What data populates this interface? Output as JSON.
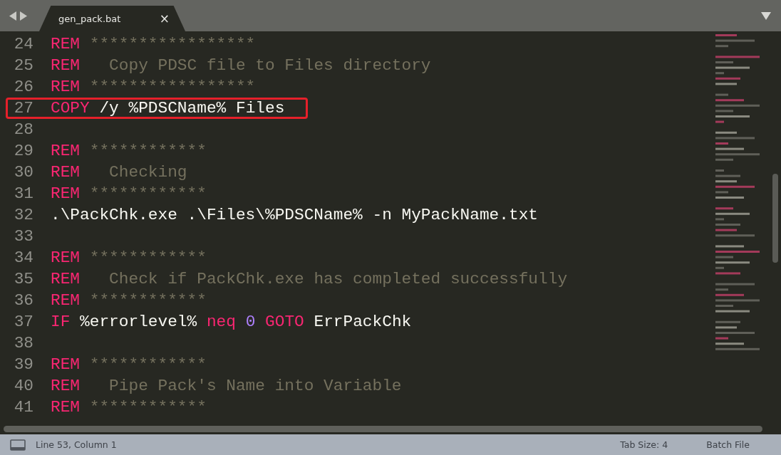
{
  "tabs": [
    {
      "title": "gen_pack.bat",
      "selected": true,
      "close": "×"
    }
  ],
  "lines": [
    {
      "number": "24",
      "highlighted": false,
      "tokens": [
        {
          "kind": "keyword",
          "text": "REM"
        },
        {
          "kind": "comment",
          "text": " *****************"
        }
      ]
    },
    {
      "number": "25",
      "highlighted": false,
      "tokens": [
        {
          "kind": "keyword",
          "text": "REM"
        },
        {
          "kind": "comment",
          "text": "   Copy PDSC file to Files directory"
        }
      ]
    },
    {
      "number": "26",
      "highlighted": false,
      "tokens": [
        {
          "kind": "keyword",
          "text": "REM"
        },
        {
          "kind": "comment",
          "text": " *****************"
        }
      ]
    },
    {
      "number": "27",
      "highlighted": true,
      "tokens": [
        {
          "kind": "keyword",
          "text": "COPY"
        },
        {
          "kind": "plain",
          "text": " /y %PDSCName% Files"
        }
      ]
    },
    {
      "number": "28",
      "highlighted": false
    },
    {
      "number": "29",
      "highlighted": false,
      "tokens": [
        {
          "kind": "keyword",
          "text": "REM"
        },
        {
          "kind": "comment",
          "text": " ************"
        }
      ]
    },
    {
      "number": "30",
      "highlighted": false,
      "tokens": [
        {
          "kind": "keyword",
          "text": "REM"
        },
        {
          "kind": "comment",
          "text": "   Checking"
        }
      ]
    },
    {
      "number": "31",
      "highlighted": false,
      "tokens": [
        {
          "kind": "keyword",
          "text": "REM"
        },
        {
          "kind": "comment",
          "text": " ************"
        }
      ]
    },
    {
      "number": "32",
      "highlighted": false,
      "tokens": [
        {
          "kind": "plain",
          "text": ".\\PackChk.exe .\\Files\\%PDSCName% -n MyPackName.txt"
        }
      ]
    },
    {
      "number": "33",
      "highlighted": false
    },
    {
      "number": "34",
      "highlighted": false,
      "tokens": [
        {
          "kind": "keyword",
          "text": "REM"
        },
        {
          "kind": "comment",
          "text": " ************"
        }
      ]
    },
    {
      "number": "35",
      "highlighted": false,
      "tokens": [
        {
          "kind": "keyword",
          "text": "REM"
        },
        {
          "kind": "comment",
          "text": "   Check if PackChk.exe has completed successfully"
        }
      ]
    },
    {
      "number": "36",
      "highlighted": false,
      "tokens": [
        {
          "kind": "keyword",
          "text": "REM"
        },
        {
          "kind": "comment",
          "text": " ************"
        }
      ]
    },
    {
      "number": "37",
      "highlighted": false,
      "tokens": [
        {
          "kind": "keyword",
          "text": "IF"
        },
        {
          "kind": "plain",
          "text": " %errorlevel% "
        },
        {
          "kind": "keyword",
          "text": "neq"
        },
        {
          "kind": "number",
          "text": " 0"
        },
        {
          "kind": "keyword",
          "text": " GOTO"
        },
        {
          "kind": "plain",
          "text": " ErrPackChk"
        }
      ]
    },
    {
      "number": "38",
      "highlighted": false
    },
    {
      "number": "39",
      "highlighted": false,
      "tokens": [
        {
          "kind": "keyword",
          "text": "REM"
        },
        {
          "kind": "comment",
          "text": " ************"
        }
      ]
    },
    {
      "number": "40",
      "highlighted": false,
      "tokens": [
        {
          "kind": "keyword",
          "text": "REM"
        },
        {
          "kind": "comment",
          "text": "   Pipe Pack's Name into Variable"
        }
      ]
    },
    {
      "number": "41",
      "highlighted": false,
      "tokens": [
        {
          "kind": "keyword",
          "text": "REM"
        },
        {
          "kind": "comment",
          "text": " ************"
        }
      ]
    }
  ],
  "status_bar": {
    "position": "Line 53, Column 1",
    "tab_size": "Tab Size: 4",
    "syntax": "Batch File"
  }
}
